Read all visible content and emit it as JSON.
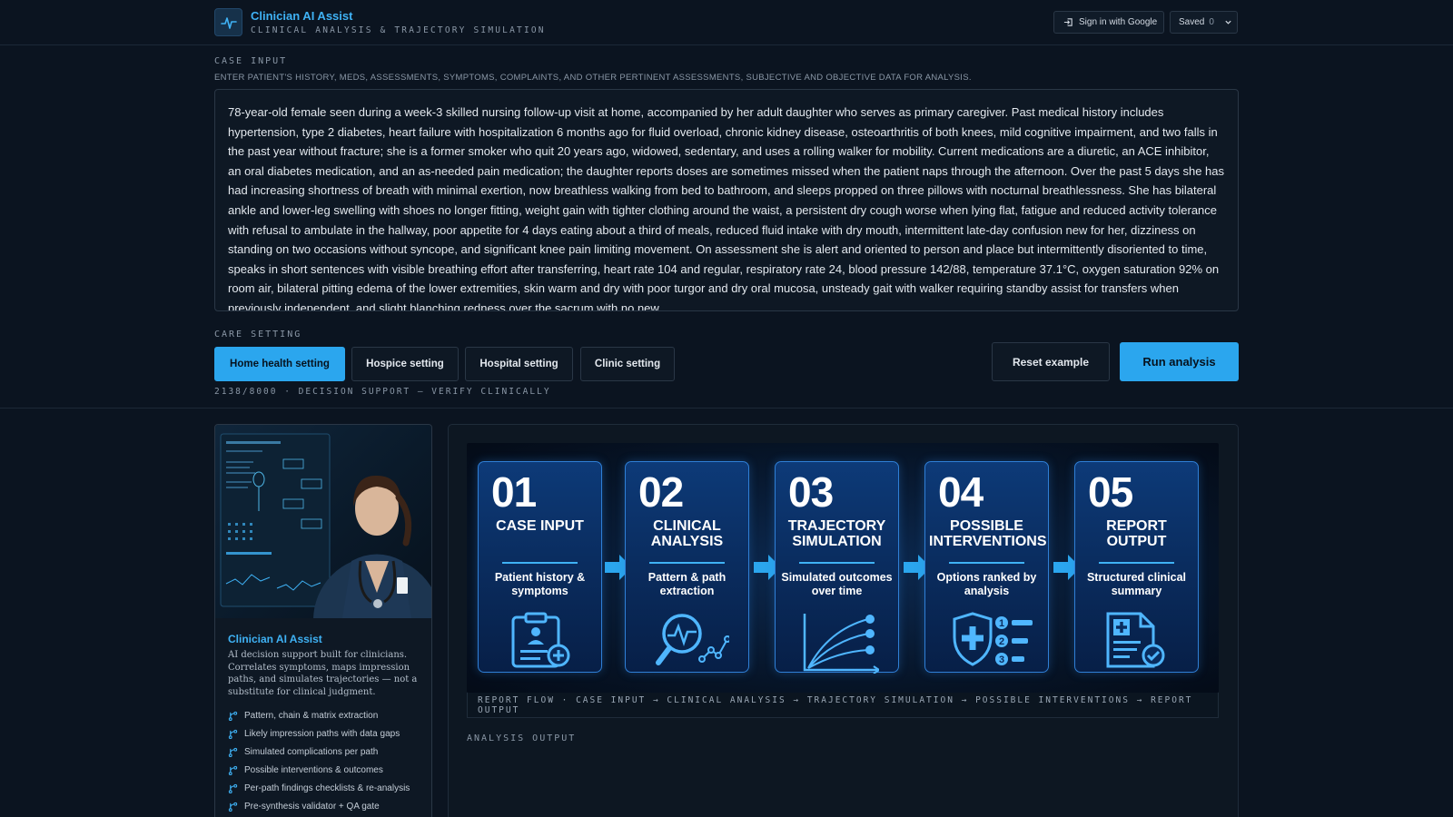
{
  "header": {
    "title": "Clinician AI Assist",
    "subtitle": "CLINICAL ANALYSIS & TRAJECTORY SIMULATION",
    "sign_in_label": "Sign in with Google",
    "saved_label": "Saved",
    "saved_count": "0"
  },
  "case_input": {
    "label": "CASE INPUT",
    "instructions": "ENTER PATIENT'S HISTORY, MEDS, ASSESSMENTS, SYMPTOMS, COMPLAINTS, AND OTHER PERTINENT ASSESSMENTS, SUBJECTIVE AND OBJECTIVE DATA FOR ANALYSIS.",
    "text": "78-year-old female seen during a week-3 skilled nursing follow-up visit at home, accompanied by her adult daughter who serves as primary caregiver. Past medical history includes hypertension, type 2 diabetes, heart failure with hospitalization 6 months ago for fluid overload, chronic kidney disease, osteoarthritis of both knees, mild cognitive impairment, and two falls in the past year without fracture; she is a former smoker who quit 20 years ago, widowed, sedentary, and uses a rolling walker for mobility. Current medications are a diuretic, an ACE inhibitor, an oral diabetes medication, and an as-needed pain medication; the daughter reports doses are sometimes missed when the patient naps through the afternoon. Over the past 5 days she has had increasing shortness of breath with minimal exertion, now breathless walking from bed to bathroom, and sleeps propped on three pillows with nocturnal breathlessness. She has bilateral ankle and lower-leg swelling with shoes no longer fitting, weight gain with tighter clothing around the waist, a persistent dry cough worse when lying flat, fatigue and reduced activity tolerance with refusal to ambulate in the hallway, poor appetite for 4 days eating about a third of meals, reduced fluid intake with dry mouth, intermittent late-day confusion new for her, dizziness on standing on two occasions without syncope, and significant knee pain limiting movement. On assessment she is alert and oriented to person and place but intermittently disoriented to time, speaks in short sentences with visible breathing effort after transferring, heart rate 104 and regular, respiratory rate 24, blood pressure 142/88, temperature 37.1°C, oxygen saturation 92% on room air, bilateral pitting edema of the lower extremities, skin warm and dry with poor turgor and dry oral mucosa, unsteady gait with walker requiring standby assist for transfers when previously independent, and slight blanching redness over the sacrum with no new"
  },
  "care_setting": {
    "label": "CARE SETTING",
    "options": [
      "Home health setting",
      "Hospice setting",
      "Hospital setting",
      "Clinic setting"
    ],
    "selected": "Home health setting",
    "reset_label": "Reset example",
    "run_label": "Run analysis",
    "counter": "2138/8000 · DECISION SUPPORT — VERIFY CLINICALLY"
  },
  "about_card": {
    "title": "Clinician AI Assist",
    "description": "AI decision support built for clinicians. Correlates symptoms, maps impression paths, and simulates trajectories — not a substitute for clinical judgment.",
    "features": [
      "Pattern, chain & matrix extraction",
      "Likely impression paths with data gaps",
      "Simulated complications per path",
      "Possible interventions & outcomes",
      "Per-path findings checklists & re-analysis",
      "Pre-synthesis validator + QA gate"
    ]
  },
  "flow": {
    "steps": [
      {
        "num": "01",
        "title": "CASE INPUT",
        "desc": "Patient history & symptoms",
        "icon": "clipboard-patient-icon"
      },
      {
        "num": "02",
        "title": "CLINICAL ANALYSIS",
        "desc": "Pattern & path extraction",
        "icon": "magnifier-pulse-icon"
      },
      {
        "num": "03",
        "title": "TRAJECTORY SIMULATION",
        "desc": "Simulated outcomes over time",
        "icon": "trajectory-chart-icon"
      },
      {
        "num": "04",
        "title": "POSSIBLE INTERVENTIONS",
        "desc": "Options ranked by analysis",
        "icon": "shield-ranked-list-icon"
      },
      {
        "num": "05",
        "title": "REPORT OUTPUT",
        "desc": "Structured clinical summary",
        "icon": "report-check-icon"
      }
    ],
    "caption": "REPORT FLOW · CASE INPUT → CLINICAL ANALYSIS → TRAJECTORY SIMULATION → POSSIBLE INTERVENTIONS → REPORT OUTPUT"
  },
  "output": {
    "label": "ANALYSIS OUTPUT"
  },
  "colors": {
    "accent": "#2ba6ee",
    "background": "#0b1420",
    "panel": "#0e1824",
    "step_border": "#2f7fd6"
  }
}
